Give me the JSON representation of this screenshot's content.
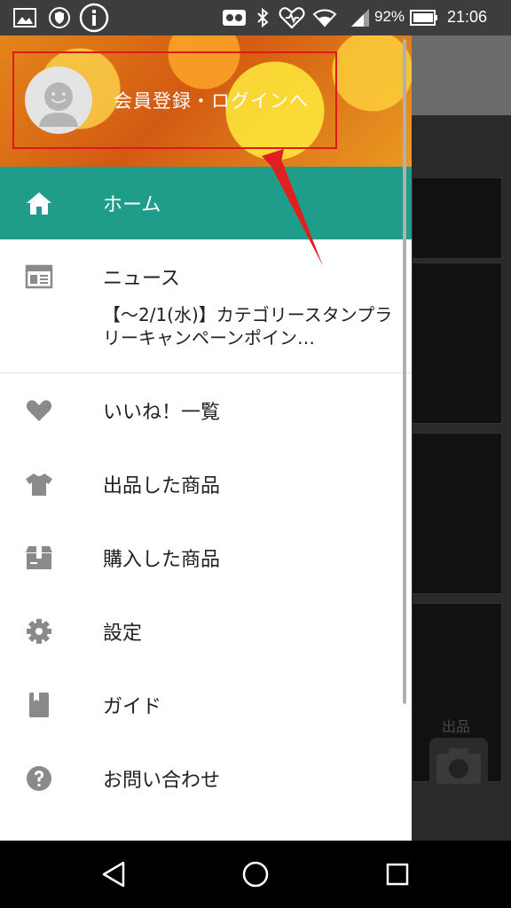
{
  "status_bar": {
    "battery": "92%",
    "time": "21:06",
    "left_icons": [
      "image-icon",
      "shield-icon",
      "info-icon"
    ],
    "right_icons": [
      "voicemail-icon",
      "bluetooth-icon",
      "health-icon",
      "wifi-icon",
      "signal-icon",
      "battery-icon"
    ]
  },
  "drawer": {
    "login_label": "会員登録・ログインへ",
    "home_label": "ホーム",
    "news": {
      "title": "ニュース",
      "body": "【～2/1(水)】カテゴリースタンプラリーキャンペーンポイン…"
    },
    "items": [
      {
        "label": "いいね！一覧",
        "icon": "heart-icon"
      },
      {
        "label": "出品した商品",
        "icon": "tshirt-icon"
      },
      {
        "label": "購入した商品",
        "icon": "package-icon"
      },
      {
        "label": "設定",
        "icon": "gear-icon"
      },
      {
        "label": "ガイド",
        "icon": "book-icon"
      },
      {
        "label": "お問い合わせ",
        "icon": "help-icon"
      }
    ]
  },
  "background": {
    "sell_label": "出品"
  },
  "colors": {
    "accent": "#1f9d8a",
    "highlight": "#e01818"
  }
}
